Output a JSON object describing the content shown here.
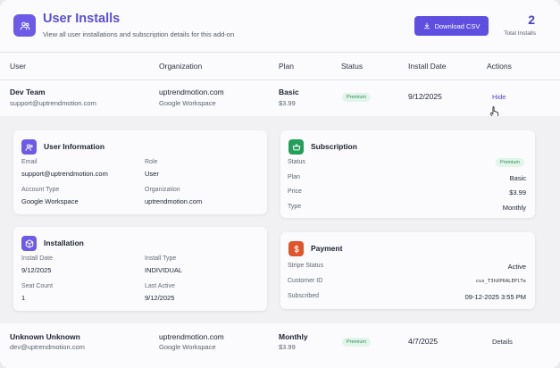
{
  "header": {
    "title": "User Installs",
    "subtitle": "View all user installations and subscription details for this add-on",
    "download_label": "Download CSV",
    "count": "2",
    "count_label": "Total Installs"
  },
  "table": {
    "columns": [
      "User",
      "Organization",
      "Plan",
      "Status",
      "Install Date",
      "Actions"
    ],
    "rows": [
      {
        "name": "Dev Team",
        "email": "support@uptrendmotion.com",
        "org": "uptrendmotion.com",
        "org_sub": "Google Workspace",
        "plan": "Basic",
        "price": "$3.99",
        "status": "Premium",
        "install_date": "9/12/2025",
        "action": "Hide"
      },
      {
        "name": "Unknown Unknown",
        "email": "dev@uptrendmotion.com",
        "org": "uptrendmotion.com",
        "org_sub": "Google Workspace",
        "plan": "Monthly",
        "price": "$3.99",
        "status": "Premium",
        "install_date": "4/7/2025",
        "action": "Details"
      }
    ]
  },
  "user_info": {
    "title": "User Information",
    "email_label": "Email",
    "email": "support@uptrendmotion.com",
    "role_label": "Role",
    "role": "User",
    "account_type_label": "Account Type",
    "account_type": "Google Workspace",
    "organization_label": "Organization",
    "organization": "uptrendmotion.com"
  },
  "subscription": {
    "title": "Subscription",
    "status_label": "Status",
    "status": "Premium",
    "plan_label": "Plan",
    "plan": "Basic",
    "price_label": "Price",
    "price": "$3.99",
    "type_label": "Type",
    "type": "Monthly"
  },
  "installation": {
    "title": "Installation",
    "install_date_label": "Install Date",
    "install_date": "9/12/2025",
    "install_type_label": "Install Type",
    "install_type": "INDIVIDUAL",
    "seat_count_label": "Seat Count",
    "seat_count": "1",
    "last_active_label": "Last Active",
    "last_active": "9/12/2025"
  },
  "payment": {
    "title": "Payment",
    "stripe_status_label": "Stripe Status",
    "stripe_status": "Active",
    "customer_id_label": "Customer ID",
    "customer_id": "cus_T3hXP6ALEPlTe",
    "subscribed_label": "Subscribed",
    "subscribed": "09-12-2025 3:55 PM"
  },
  "colors": {
    "accent": "#5f4fe0",
    "title": "#5a4fd6",
    "premium_bg": "#e2f5ea",
    "premium_text": "#2e8b57",
    "subscription_icon": "#22a05a",
    "payment_icon": "#e0542c",
    "hide_link": "#4f46c8"
  },
  "icons": {
    "logo": "users-icon",
    "download": "download-icon",
    "user_info": "user-icon",
    "subscription": "basket-icon",
    "installation": "box-icon",
    "payment": "dollar-icon",
    "cursor": "hand-cursor-icon"
  }
}
